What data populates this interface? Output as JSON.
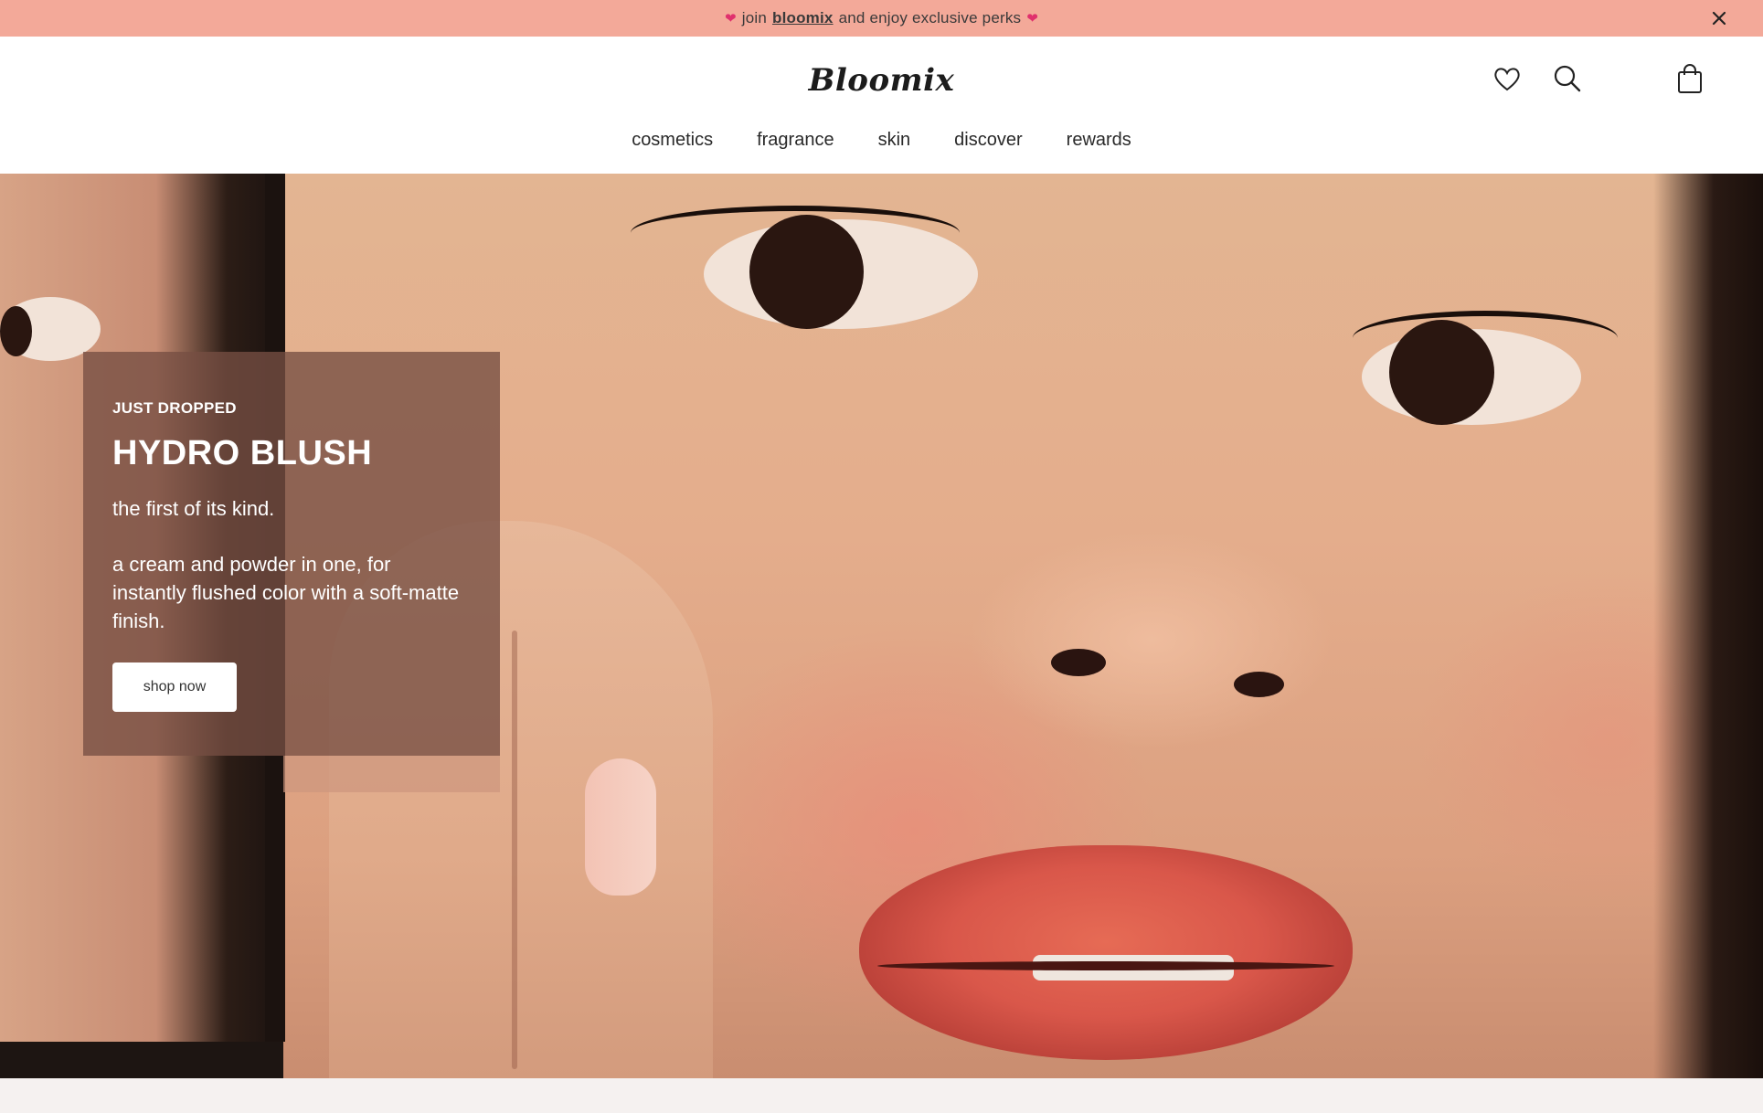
{
  "announcement": {
    "prefix": "join",
    "brand": "bloomix",
    "suffix": "and enjoy exclusive perks",
    "heart_icon": "heart-icon",
    "close_icon": "close-icon"
  },
  "header": {
    "logo": "Bloomix",
    "icons": [
      "heart-icon",
      "search-icon",
      "shopping-bag-icon"
    ]
  },
  "nav": {
    "items": [
      {
        "label": "cosmetics"
      },
      {
        "label": "fragrance"
      },
      {
        "label": "skin"
      },
      {
        "label": "discover"
      },
      {
        "label": "rewards"
      }
    ]
  },
  "hero": {
    "kicker": "JUST DROPPED",
    "title": "HYDRO BLUSH",
    "subtitle": "the first of its kind.",
    "description": "a cream and powder in one, for instantly flushed color with a soft-matte finish.",
    "cta_label": "shop now"
  },
  "colors": {
    "announcement_bg": "#f3a999",
    "heart_accent": "#e0306d",
    "promo_card_bg": "#764e42"
  }
}
